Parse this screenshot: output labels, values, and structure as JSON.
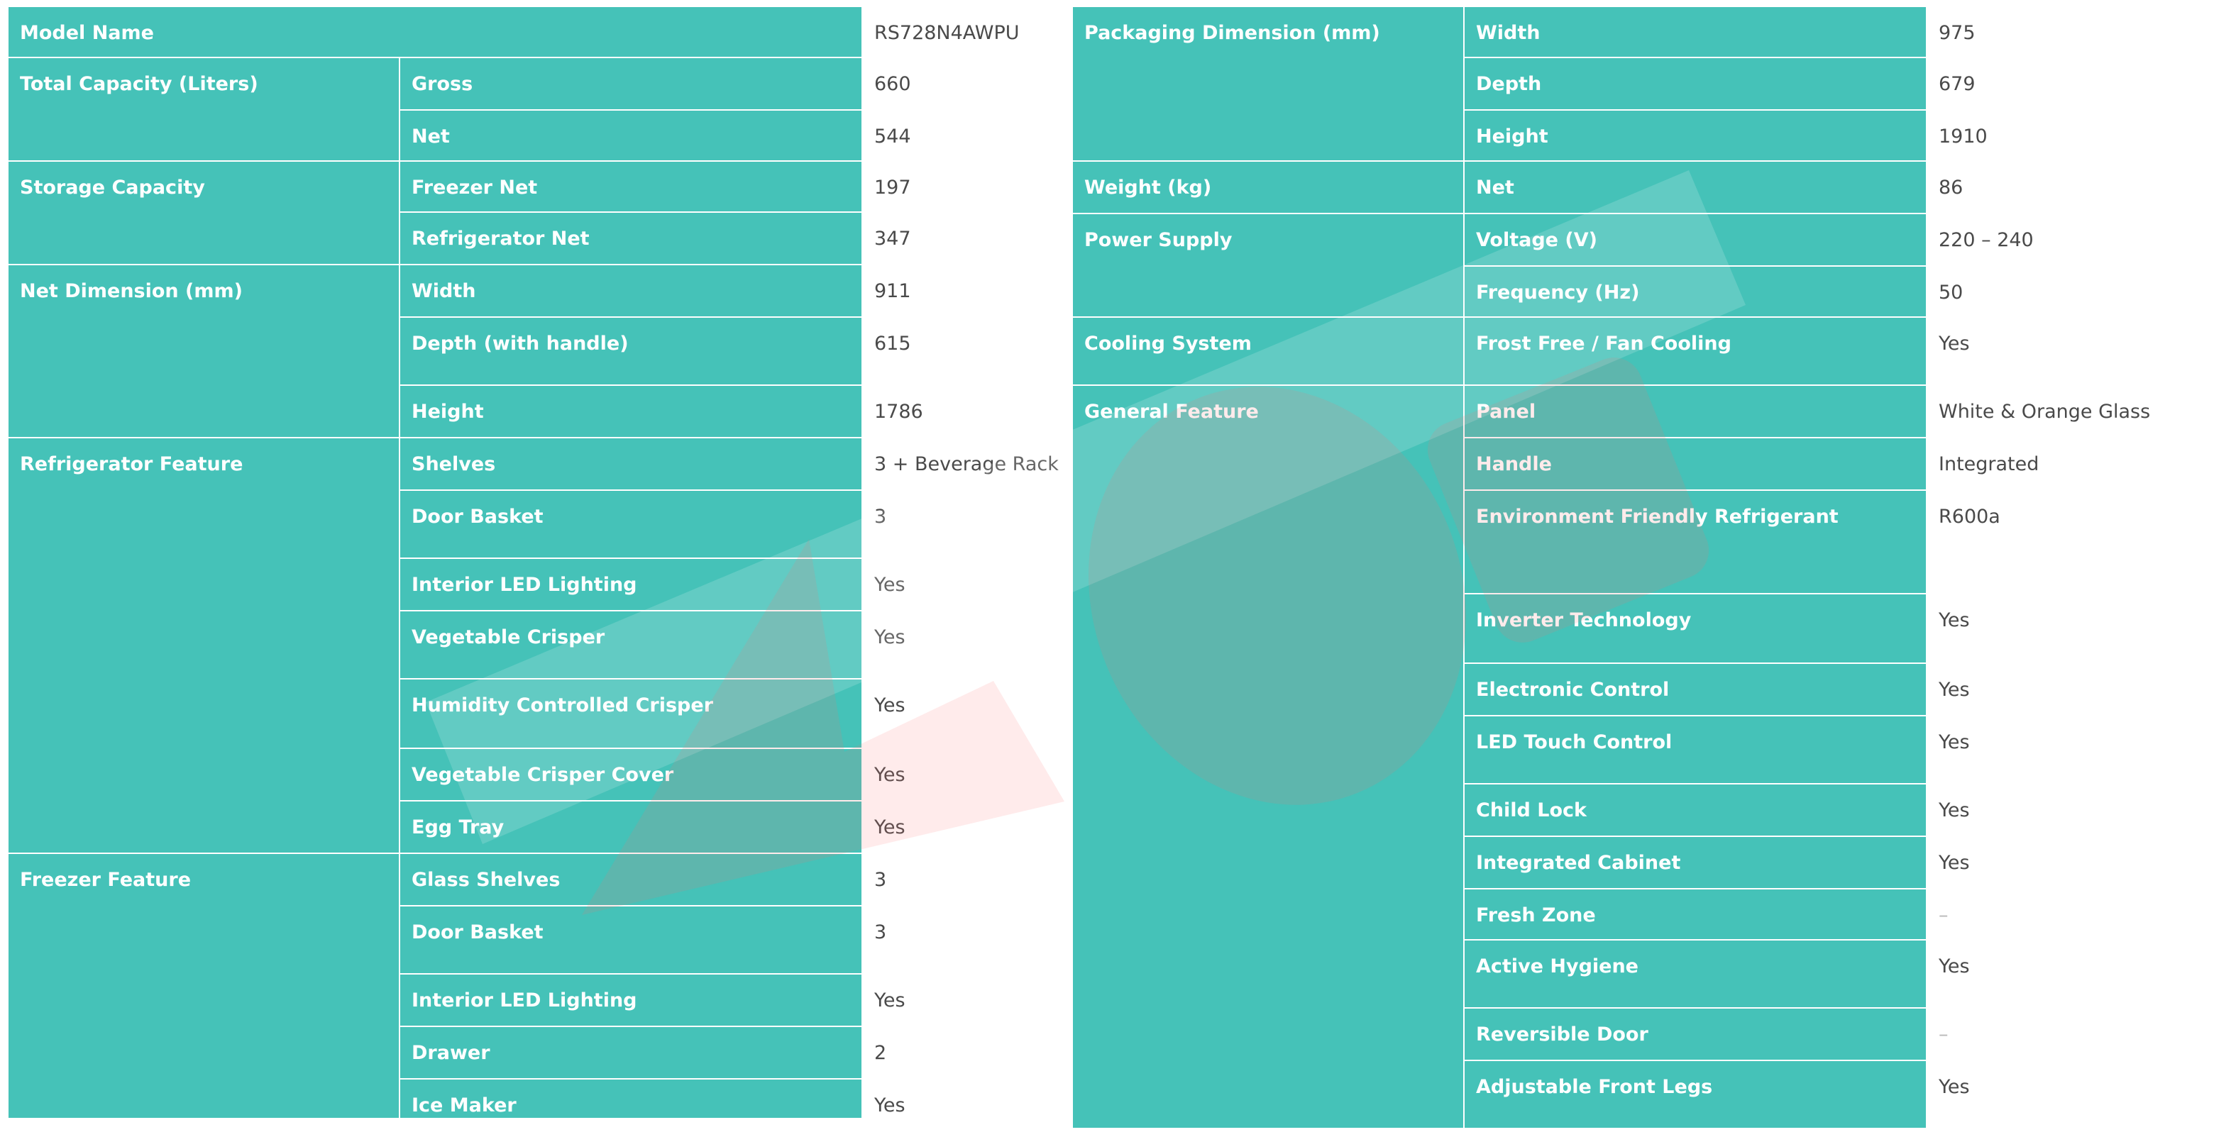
{
  "left": {
    "model_name": {
      "label": "Model Name",
      "value": "RS728N4AWPU"
    },
    "groups": [
      {
        "label": "Total Capacity (Liters)",
        "rows": [
          {
            "label": "Gross",
            "value": "660"
          },
          {
            "label": "Net",
            "value": "544"
          }
        ]
      },
      {
        "label": "Storage Capacity",
        "rows": [
          {
            "label": "Freezer Net",
            "value": "197"
          },
          {
            "label": "Refrigerator Net",
            "value": "347"
          }
        ]
      },
      {
        "label": "Net Dimension (mm)",
        "rows": [
          {
            "label": "Width",
            "value": "911"
          },
          {
            "label": "Depth (with handle)",
            "value": "615"
          },
          {
            "label": "Height",
            "value": "1786"
          }
        ]
      },
      {
        "label": "Refrigerator Feature",
        "rows": [
          {
            "label": "Shelves",
            "value": "3 + Beverage Rack"
          },
          {
            "label": "Door Basket",
            "value": "3"
          },
          {
            "label": "Interior LED Lighting",
            "value": "Yes"
          },
          {
            "label": "Vegetable Crisper",
            "value": "Yes"
          },
          {
            "label": "Humidity Controlled Crisper",
            "value": "Yes"
          },
          {
            "label": "Vegetable Crisper Cover",
            "value": "Yes"
          },
          {
            "label": "Egg Tray",
            "value": "Yes"
          }
        ]
      },
      {
        "label": "Freezer Feature",
        "rows": [
          {
            "label": "Glass Shelves",
            "value": "3"
          },
          {
            "label": "Door Basket",
            "value": "3"
          },
          {
            "label": "Interior LED Lighting",
            "value": "Yes"
          },
          {
            "label": "Drawer",
            "value": "2"
          },
          {
            "label": "Ice Maker",
            "value": "Yes"
          }
        ]
      }
    ]
  },
  "right": {
    "groups": [
      {
        "label": "Packaging Dimension (mm)",
        "rows": [
          {
            "label": "Width",
            "value": "975"
          },
          {
            "label": "Depth",
            "value": "679"
          },
          {
            "label": "Height",
            "value": "1910"
          }
        ]
      },
      {
        "label": "Weight (kg)",
        "rows": [
          {
            "label": "Net",
            "value": "86"
          }
        ]
      },
      {
        "label": "Power Supply",
        "rows": [
          {
            "label": "Voltage (V)",
            "value": "220 – 240"
          },
          {
            "label": "Frequency (Hz)",
            "value": "50"
          }
        ]
      },
      {
        "label": "Cooling System",
        "rows": [
          {
            "label": "Frost Free / Fan Cooling",
            "value": "Yes"
          }
        ]
      },
      {
        "label": "General Feature",
        "rows": [
          {
            "label": "Panel",
            "value": "White & Orange Glass"
          },
          {
            "label": "Handle",
            "value": "Integrated"
          },
          {
            "label": "Environment Friendly Refrigerant",
            "value": "R600a"
          },
          {
            "label": "Inverter Technology",
            "value": "Yes"
          },
          {
            "label": "Electronic Control",
            "value": "Yes"
          },
          {
            "label": "LED Touch Control",
            "value": "Yes"
          },
          {
            "label": "Child Lock",
            "value": "Yes"
          },
          {
            "label": "Integrated Cabinet",
            "value": "Yes"
          },
          {
            "label": "Fresh Zone",
            "value": "–"
          },
          {
            "label": "Active Hygiene",
            "value": "Yes"
          },
          {
            "label": "Reversible Door",
            "value": "–"
          },
          {
            "label": "Adjustable Front Legs",
            "value": "Yes"
          }
        ]
      }
    ]
  },
  "colors": {
    "teal": "#45c2b8",
    "text_light": "#ffffff",
    "value_text": "#4a4a4a",
    "watermark_red": "#ff6b6b"
  }
}
